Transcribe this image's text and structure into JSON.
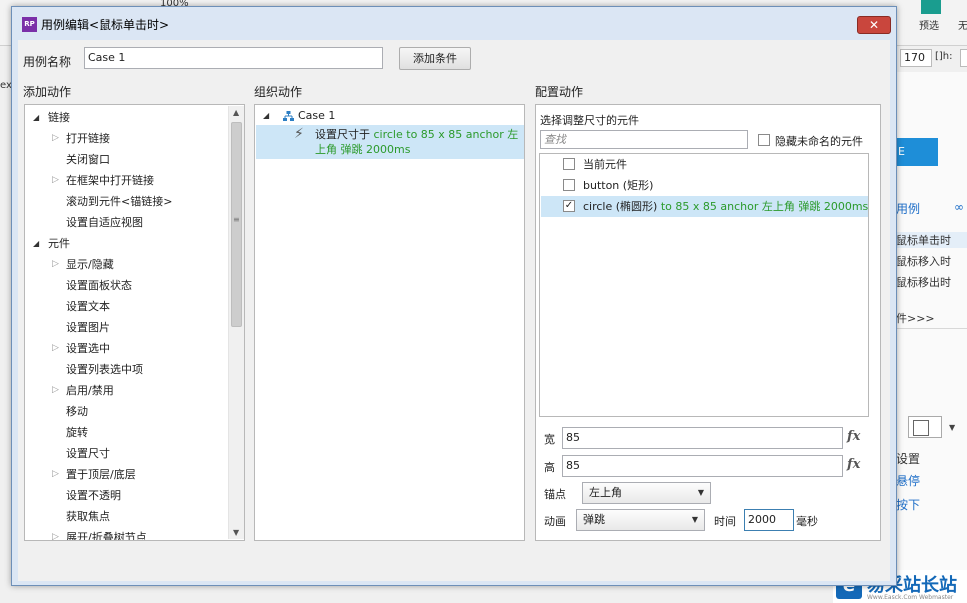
{
  "background": {
    "zoom": "100%",
    "preview_label": "预选",
    "publish_label": "无",
    "ex_label": "ex",
    "width_value": "170",
    "height_label": "[]h:",
    "height_value": "4",
    "panel_tab": "E",
    "usecase_link": "用例",
    "events": [
      "鼠标单击时",
      "鼠标移入时",
      "鼠标移出时"
    ],
    "more_events": "件>>>",
    "setting_label": "设置",
    "hover_link": "悬停",
    "press_link": "按下",
    "watermark_title": "易采站长站",
    "watermark_sub": "Www.Easck.Com Webmaster"
  },
  "dialog": {
    "title": "用例编辑<鼠标单击时>",
    "icon_text": "RP",
    "close_label": "✕",
    "case_name_label": "用例名称",
    "case_name_value": "Case 1",
    "add_condition_button": "添加条件",
    "add_action_header": "添加动作",
    "organize_header": "组织动作",
    "configure_header": "配置动作"
  },
  "action_tree": [
    {
      "label": "链接",
      "level": 0,
      "expander": "open"
    },
    {
      "label": "打开链接",
      "level": 1,
      "expander": "closed"
    },
    {
      "label": "关闭窗口",
      "level": 1,
      "expander": "none"
    },
    {
      "label": "在框架中打开链接",
      "level": 1,
      "expander": "closed"
    },
    {
      "label": "滚动到元件<锚链接>",
      "level": 1,
      "expander": "none"
    },
    {
      "label": "设置自适应视图",
      "level": 1,
      "expander": "none"
    },
    {
      "label": "元件",
      "level": 0,
      "expander": "open"
    },
    {
      "label": "显示/隐藏",
      "level": 1,
      "expander": "closed"
    },
    {
      "label": "设置面板状态",
      "level": 1,
      "expander": "none"
    },
    {
      "label": "设置文本",
      "level": 1,
      "expander": "none"
    },
    {
      "label": "设置图片",
      "level": 1,
      "expander": "none"
    },
    {
      "label": "设置选中",
      "level": 1,
      "expander": "closed"
    },
    {
      "label": "设置列表选中项",
      "level": 1,
      "expander": "none"
    },
    {
      "label": "启用/禁用",
      "level": 1,
      "expander": "closed"
    },
    {
      "label": "移动",
      "level": 1,
      "expander": "none"
    },
    {
      "label": "旋转",
      "level": 1,
      "expander": "none"
    },
    {
      "label": "设置尺寸",
      "level": 1,
      "expander": "none"
    },
    {
      "label": "置于顶层/底层",
      "level": 1,
      "expander": "closed"
    },
    {
      "label": "设置不透明",
      "level": 1,
      "expander": "none"
    },
    {
      "label": "获取焦点",
      "level": 1,
      "expander": "none"
    },
    {
      "label": "展开/折叠树节点",
      "level": 1,
      "expander": "closed"
    }
  ],
  "organize": {
    "case_label": "Case 1",
    "action_prefix": "设置尺寸于",
    "action_detail": " circle to 85 x 85 anchor 左上角 弹跳 2000ms"
  },
  "configure": {
    "select_label": "选择调整尺寸的元件",
    "search_placeholder": "查找",
    "hide_unnamed_label": "隐藏未命名的元件",
    "elements": [
      {
        "label": "当前元件",
        "detail": "",
        "checked": false
      },
      {
        "label": "button (矩形)",
        "detail": "",
        "checked": false
      },
      {
        "label": "circle (椭圆形)",
        "detail": " to 85 x 85 anchor 左上角 弹跳 2000ms",
        "checked": true
      }
    ],
    "width_label": "宽",
    "width_value": "85",
    "height_label": "高",
    "height_value": "85",
    "fx_label": "fx",
    "anchor_label": "锚点",
    "anchor_value": "左上角",
    "animate_label": "动画",
    "animate_value": "弹跳",
    "time_label": "时间",
    "time_value": "2000",
    "time_unit": "毫秒"
  }
}
